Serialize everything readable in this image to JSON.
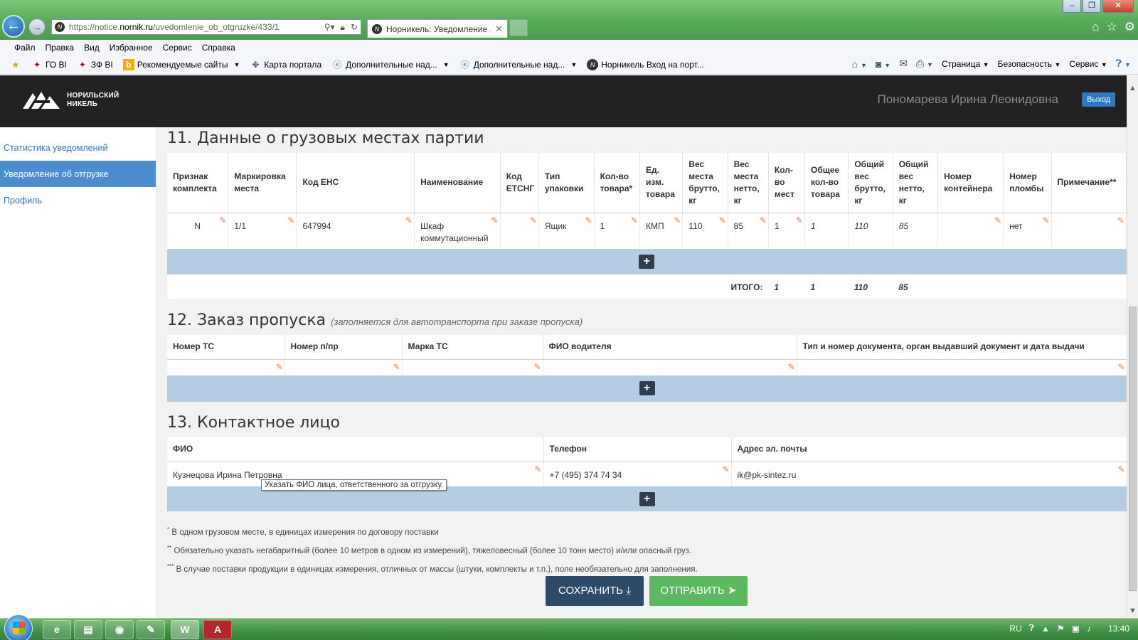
{
  "browser": {
    "url_prefix": "https://notice.",
    "url_domain": "nornik.ru",
    "url_path": "/uvedomlenie_ob_otgruzke/433/1",
    "tab_title": "Норникель: Уведомление ...",
    "menu": [
      "Файл",
      "Правка",
      "Вид",
      "Избранное",
      "Сервис",
      "Справка"
    ],
    "favorites": [
      "ГО ВІ",
      "ЗФ ВІ",
      "Рекомендуемые сайты",
      "Карта портала",
      "Дополнительные над...",
      "Дополнительные над...",
      "Норникель Вход на порт..."
    ],
    "commands": [
      "Страница",
      "Безопасность",
      "Сервис"
    ]
  },
  "header": {
    "logo_line1": "НОРИЛЬСКИЙ",
    "logo_line2": "НИКЕЛЬ",
    "user_name": "Пономарева Ирина Леонидовна",
    "logout": "Выход"
  },
  "sidebar": {
    "items": [
      "Статистика уведомлений",
      "Уведомление об отгрузке",
      "Профиль"
    ]
  },
  "section11": {
    "title": "11. Данные о грузовых местах партии",
    "headers": [
      "Признак комплекта",
      "Маркировка места",
      "Код ЕНС",
      "Наименование",
      "Код ЕТСНГ",
      "Тип упаковки",
      "Кол-во товара*",
      "Ед. изм. товара",
      "Вес места брутто, кг",
      "Вес места нетто, кг",
      "Кол-во мест",
      "Общее кол-во товара",
      "Общий вес брутто, кг",
      "Общий вес нетто, кг",
      "Номер контейнера",
      "Номер пломбы",
      "Примечание**"
    ],
    "row": [
      "N",
      "1/1",
      "647994",
      "Шкаф коммутационный",
      "",
      "Ящик",
      "1",
      "КМП",
      "110",
      "85",
      "1",
      "1",
      "110",
      "85",
      "",
      "нет",
      ""
    ],
    "total_label": "ИТОГО:",
    "totals": [
      "1",
      "1",
      "110",
      "85"
    ]
  },
  "section12": {
    "title": "12. Заказ пропуска",
    "note": "(заполняется для автотранспорта при заказе пропуска)",
    "headers": [
      "Номер ТС",
      "Номер п/пр",
      "Марка ТС",
      "ФИО водителя",
      "Тип и номер документа, орган выдавший документ и дата выдачи"
    ]
  },
  "section13": {
    "title": "13. Контактное лицо",
    "headers": [
      "ФИО",
      "Телефон",
      "Адрес эл. почты"
    ],
    "row": [
      "Кузнецова Ирина Петровна",
      "+7 (495) 374 74 34",
      "ik@pk-sintez.ru"
    ],
    "tooltip": "Указать ФИО лица, ответственного за отгрузку."
  },
  "footnotes": [
    "В одном грузовом месте, в единицах измерения по договору поставки",
    "Обязательно указать негабаритный (более 10 метров в одном из измерений), тяжеловесный (более 10 тонн место) и/или опасный груз.",
    "В случае поставки продукции в единицах измерения, отличных от массы (штуки, комплекты и т.п.), поле необязательно для заполнения."
  ],
  "buttons": {
    "save": "СОХРАНИТЬ",
    "send": "ОТПРАВИТЬ"
  },
  "taskbar": {
    "lang": "RU",
    "time": "13:40"
  },
  "colors": {
    "accent": "#4a8ed1",
    "add_row": "#b5cde2",
    "save": "#2c4b6b",
    "send": "#5cb85c",
    "edit_icon": "#e9834a"
  }
}
